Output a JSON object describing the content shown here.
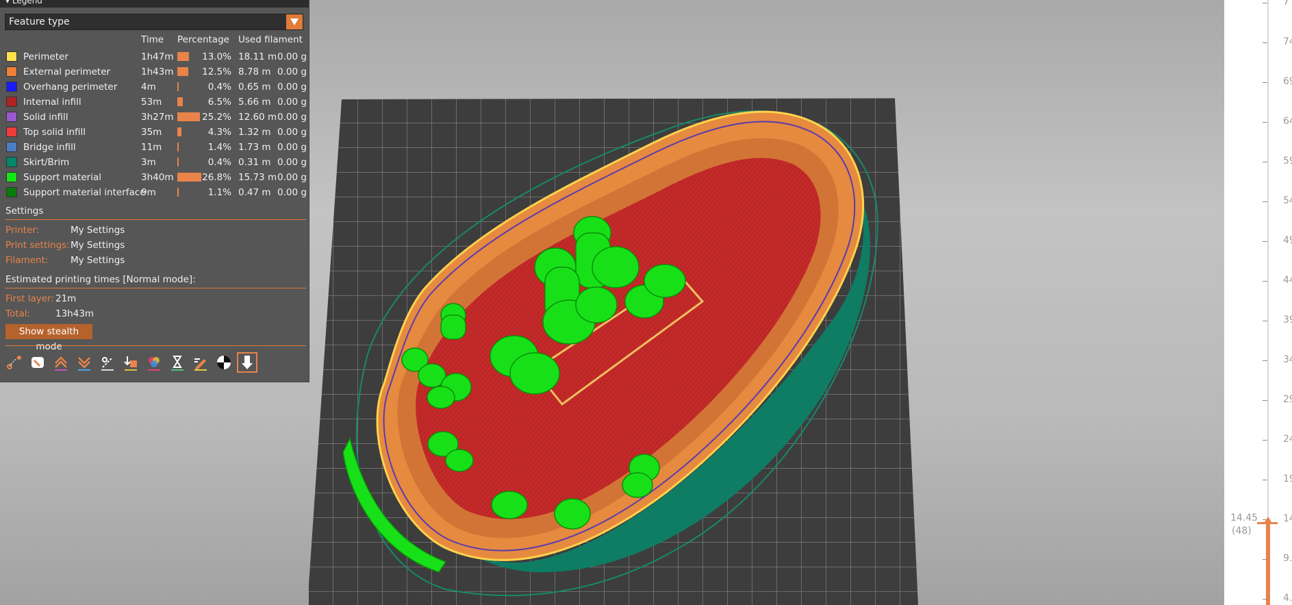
{
  "legend": {
    "title": "Legend",
    "feature_type": "Feature type",
    "headers": {
      "time": "Time",
      "percentage": "Percentage",
      "used_filament": "Used filament"
    },
    "rows": [
      {
        "name": "Perimeter",
        "color": "#ffe04d",
        "time": "1h47m",
        "pct": "13.0%",
        "pct_value": 13.0,
        "length": "18.11 m",
        "weight": "0.00 g"
      },
      {
        "name": "External perimeter",
        "color": "#f07f37",
        "time": "1h43m",
        "pct": "12.5%",
        "pct_value": 12.5,
        "length": "8.78 m",
        "weight": "0.00 g"
      },
      {
        "name": "Overhang perimeter",
        "color": "#1a1aff",
        "time": "4m",
        "pct": "0.4%",
        "pct_value": 0.4,
        "length": "0.65 m",
        "weight": "0.00 g"
      },
      {
        "name": "Internal infill",
        "color": "#b22222",
        "time": "53m",
        "pct": "6.5%",
        "pct_value": 6.5,
        "length": "5.66 m",
        "weight": "0.00 g"
      },
      {
        "name": "Solid infill",
        "color": "#9b59d0",
        "time": "3h27m",
        "pct": "25.2%",
        "pct_value": 25.2,
        "length": "12.60 m",
        "weight": "0.00 g"
      },
      {
        "name": "Top solid infill",
        "color": "#f03c3c",
        "time": "35m",
        "pct": "4.3%",
        "pct_value": 4.3,
        "length": "1.32 m",
        "weight": "0.00 g"
      },
      {
        "name": "Bridge infill",
        "color": "#4b7ec1",
        "time": "11m",
        "pct": "1.4%",
        "pct_value": 1.4,
        "length": "1.73 m",
        "weight": "0.00 g"
      },
      {
        "name": "Skirt/Brim",
        "color": "#00876a",
        "time": "3m",
        "pct": "0.4%",
        "pct_value": 0.4,
        "length": "0.31 m",
        "weight": "0.00 g"
      },
      {
        "name": "Support material",
        "color": "#14e614",
        "time": "3h40m",
        "pct": "26.8%",
        "pct_value": 26.8,
        "length": "15.73 m",
        "weight": "0.00 g"
      },
      {
        "name": "Support material interface",
        "color": "#0a7a0a",
        "time": "9m",
        "pct": "1.1%",
        "pct_value": 1.1,
        "length": "0.47 m",
        "weight": "0.00 g"
      }
    ],
    "settings": {
      "title": "Settings",
      "printer_label": "Printer:",
      "printer": "My Settings",
      "print_settings_label": "Print settings:",
      "print_settings": "My Settings",
      "filament_label": "Filament:",
      "filament": "My Settings"
    },
    "times": {
      "title": "Estimated printing times [Normal mode]:",
      "first_layer_label": "First layer:",
      "first_layer": "21m",
      "total_label": "Total:",
      "total": "13h43m"
    },
    "stealth_button": "Show stealth mode",
    "toolbar_icons": [
      "travel-icon",
      "wipe-icon",
      "retractions-icon",
      "deretractions-icon",
      "seams-icon",
      "tool-changes-icon",
      "color-changes-icon",
      "pause-prints-icon",
      "custom-gcodes-icon",
      "center-of-gravity-icon",
      "shells-icon"
    ]
  },
  "slider": {
    "ticks": [
      "7",
      "74",
      "69",
      "64",
      "59",
      "54",
      "49",
      "44",
      "39",
      "34",
      "29",
      "24",
      "19",
      "14",
      "9.",
      "4."
    ],
    "current_height": "14.45",
    "current_layer": "(48)"
  },
  "colors": {
    "accent": "#e07b39",
    "panel": "#565656",
    "bed": "#3d3d3d"
  }
}
